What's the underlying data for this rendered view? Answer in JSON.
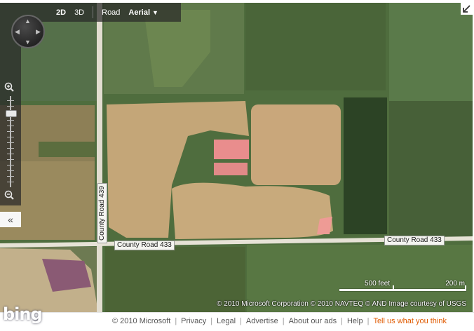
{
  "toolbar": {
    "view_2d": "2D",
    "view_3d": "3D",
    "road": "Road",
    "aerial": "Aerial"
  },
  "map": {
    "imagery": "aerial",
    "road_labels": {
      "county_road_439": "County Road 439",
      "county_road_433_west": "County Road 433",
      "county_road_433_east": "County Road 433"
    }
  },
  "nav": {
    "zoom_in_icon": "zoom-in-icon",
    "zoom_out_icon": "zoom-out-icon",
    "collapse_glyph": "«"
  },
  "scale": {
    "feet": "500 feet",
    "meters": "200 m"
  },
  "copyright": "© 2010 Microsoft Corporation   © 2010 NAVTEQ   © AND   Image courtesy of USGS",
  "footer": {
    "logo": "bing",
    "microsoft": "© 2010 Microsoft",
    "privacy": "Privacy",
    "legal": "Legal",
    "advertise": "Advertise",
    "about_ads": "About our ads",
    "help": "Help",
    "feedback": "Tell us what you think"
  },
  "colors": {
    "feedback_link": "#e05a00",
    "toolbar_bg": "#282828"
  }
}
